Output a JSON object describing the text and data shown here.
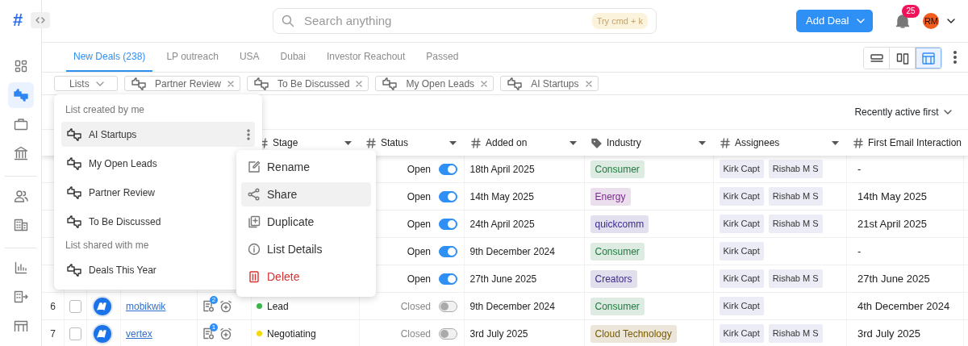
{
  "header": {
    "logo": "#",
    "search": {
      "placeholder": "Search anything",
      "shortcut": "Try cmd + k"
    },
    "add_button": "Add Deal",
    "notifications": "25",
    "avatar": "RM"
  },
  "sidebar": {
    "groups": [
      {
        "items": [
          {
            "kind": "grid",
            "selected": false
          },
          {
            "kind": "thumbs",
            "selected": true
          },
          {
            "kind": "briefcase",
            "selected": false
          },
          {
            "kind": "bank",
            "selected": false
          }
        ]
      },
      {
        "items": [
          {
            "kind": "people",
            "selected": false
          },
          {
            "kind": "building",
            "selected": false
          }
        ]
      },
      {
        "items": [
          {
            "kind": "chart",
            "selected": false
          },
          {
            "kind": "export",
            "selected": false
          },
          {
            "kind": "table",
            "selected": false
          }
        ]
      }
    ]
  },
  "tabs": [
    {
      "label": "New Deals (238)",
      "selected": true
    },
    {
      "label": "LP outreach",
      "selected": false
    },
    {
      "label": "USA",
      "selected": false
    },
    {
      "label": "Dubai",
      "selected": false
    },
    {
      "label": "Investor Reachout",
      "selected": false
    },
    {
      "label": "Passed",
      "selected": false
    }
  ],
  "views": [
    {
      "kind": "rows",
      "selected": false
    },
    {
      "kind": "columns",
      "selected": false
    },
    {
      "kind": "table",
      "selected": true
    }
  ],
  "filters": {
    "lists_label": "Lists",
    "chips": [
      "Partner Review",
      "To Be Discussed",
      "My Open Leads",
      "AI Startups"
    ]
  },
  "sort": "Recently active first",
  "table": {
    "columns": [
      {
        "label": "Stage",
        "kind": "hash"
      },
      {
        "label": "Status",
        "kind": "hash"
      },
      {
        "label": "Added on",
        "kind": "hash"
      },
      {
        "label": "Industry",
        "kind": "tag"
      },
      {
        "label": "Assignees",
        "kind": "hash"
      },
      {
        "label": "First Email Interaction",
        "kind": "hash"
      }
    ],
    "rows": [
      {
        "status": "Open",
        "on": true,
        "added": "18th April 2025",
        "industry": {
          "label": "Consumer",
          "color": "#1f7a3f"
        },
        "assignees": [
          "Kirk Capt",
          "Rishab M S"
        ],
        "first_email": "-"
      },
      {
        "status": "Open",
        "on": true,
        "added": "14th May 2025",
        "industry": {
          "label": "Energy",
          "color": "#7b2b8c"
        },
        "assignees": [
          "Kirk Capt",
          "Rishab M S"
        ],
        "first_email": "14th May 2025"
      },
      {
        "status": "Open",
        "on": true,
        "added": "24th April 2025",
        "industry": {
          "label": "quickcomm",
          "color": "#3b2a8e"
        },
        "assignees": [
          "Kirk Capt",
          "Rishab M S"
        ],
        "first_email": "21st April 2025"
      },
      {
        "status": "Open",
        "on": true,
        "added": "9th December 2024",
        "industry": {
          "label": "Consumer",
          "color": "#1f7a3f"
        },
        "assignees": [
          "Kirk Capt"
        ],
        "first_email": "-"
      },
      {
        "status": "Open",
        "on": true,
        "added": "27th June 2025",
        "industry": {
          "label": "Creators",
          "color": "#3d2a8a"
        },
        "assignees": [
          "Kirk Capt",
          "Rishab M S"
        ],
        "first_email": "27th June 2025"
      },
      {
        "number": "6",
        "checked": false,
        "company": "mobikwik",
        "notes": "2",
        "stage": {
          "label": "Lead",
          "color": "#3bb54a"
        },
        "status": "Closed",
        "on": false,
        "added": "9th December 2024",
        "industry": {
          "label": "Consumer",
          "color": "#1f7a3f"
        },
        "assignees": [
          "Kirk Capt"
        ],
        "first_email": "4th December 2024"
      },
      {
        "number": "7",
        "checked": false,
        "company": "vertex",
        "notes": "1",
        "stage": {
          "label": "Negotiating",
          "color": "#f5d90a"
        },
        "status": "Closed",
        "on": false,
        "added": "3rd July 2025",
        "industry": {
          "label": "Cloud Technology",
          "color": "#7a5a00"
        },
        "assignees": [
          "Kirk Capt",
          "Rishab M S"
        ],
        "first_email": "3rd July 2025"
      }
    ]
  },
  "lists_menu": {
    "sections": [
      {
        "title": "List created by me",
        "items": [
          {
            "label": "AI Startups",
            "selected": true
          },
          {
            "label": "My Open Leads",
            "selected": false
          },
          {
            "label": "Partner Review",
            "selected": false
          },
          {
            "label": "To Be Discussed",
            "selected": false
          }
        ]
      },
      {
        "title": "List shared with me",
        "items": [
          {
            "label": "Deals This Year",
            "selected": false
          }
        ]
      }
    ]
  },
  "context_menu": {
    "items": [
      {
        "label": "Rename",
        "kind": "rename",
        "selected": false
      },
      {
        "label": "Share",
        "kind": "share",
        "selected": true
      },
      {
        "label": "Duplicate",
        "kind": "duplicate",
        "selected": false
      },
      {
        "label": "List Details",
        "kind": "details",
        "selected": false
      },
      {
        "label": "Delete",
        "kind": "delete",
        "selected": false
      }
    ]
  }
}
